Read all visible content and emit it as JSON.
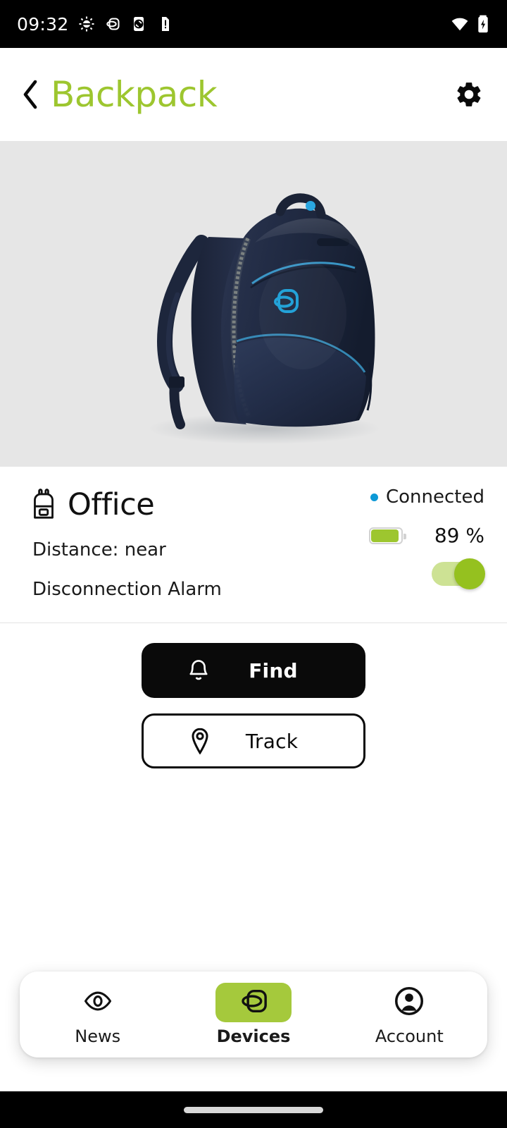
{
  "status_bar": {
    "time": "09:32",
    "left_icons": [
      "android-debug-icon",
      "tracker-device-icon",
      "phone-sync-icon",
      "sd-card-alert-icon"
    ],
    "right_icons": [
      "wifi-icon",
      "battery-charging-icon"
    ]
  },
  "header": {
    "back_label": "‹",
    "title": "Backpack",
    "settings_icon": "gear-icon",
    "title_color": "#9DC62F"
  },
  "product": {
    "image_alt": "navy-blue-leather-backpack",
    "background_color": "#e6e6e6"
  },
  "device": {
    "icon": "backpack-icon",
    "name": "Office",
    "distance_label": "Distance: near",
    "alarm_label": "Disconnection Alarm",
    "alarm_enabled": true,
    "status_text": "Connected",
    "status_dot_color": "#0d99d6",
    "battery_percent_label": "89 %",
    "battery_level": 89,
    "battery_color": "#9DC62F"
  },
  "actions": {
    "find": {
      "label": "Find",
      "icon": "bell-icon"
    },
    "track": {
      "label": "Track",
      "icon": "location-pin-icon"
    }
  },
  "bottom_nav": {
    "items": [
      {
        "label": "News",
        "icon": "eye-icon",
        "active": false
      },
      {
        "label": "Devices",
        "icon": "tracker-device-icon",
        "active": true
      },
      {
        "label": "Account",
        "icon": "account-circle-icon",
        "active": false
      }
    ],
    "active_color": "#A5C93C"
  }
}
